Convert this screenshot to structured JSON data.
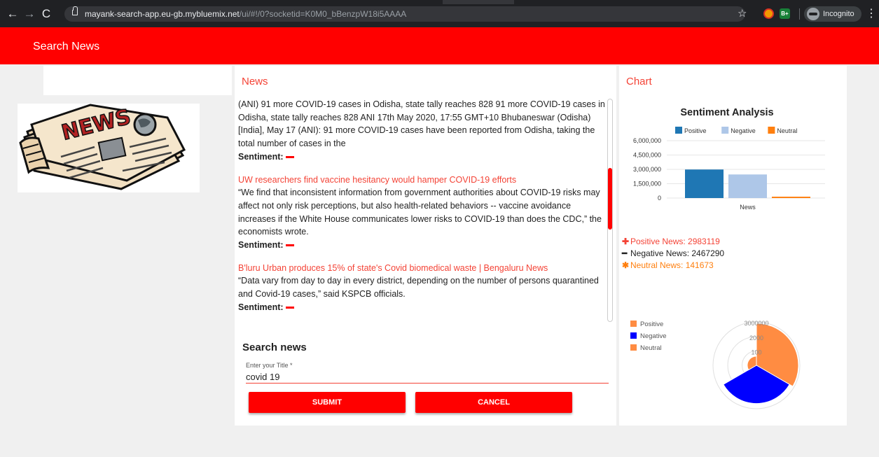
{
  "browser": {
    "url_host": "mayank-search-app.eu-gb.mybluemix.net",
    "url_path": "/ui/#!/0?socketid=K0M0_bBenzpW18i5AAAA",
    "incognito_label": "Incognito",
    "back_icon": "arrow-left-icon",
    "forward_icon": "arrow-right-icon",
    "reload_icon": "reload-icon",
    "bookmark_icon": "star-icon",
    "menu_icon": "kebab-icon"
  },
  "app": {
    "title": "Search News",
    "accent": "#ff0000"
  },
  "news": {
    "title": "News",
    "articles": [
      {
        "title": "",
        "body": "(ANI) 91 more COVID-19 cases in Odisha, state tally reaches 828 91 more COVID-19 cases in Odisha, state tally reaches 828 ANI 17th May 2020, 17:55 GMT+10 Bhubaneswar (Odisha) [India], May 17 (ANI): 91 more COVID-19 cases have been reported from Odisha, taking the total number of cases in the",
        "sentiment_label": "Sentiment:"
      },
      {
        "title": "UW researchers find vaccine hesitancy would hamper COVID-19 efforts",
        "body": "“We find that inconsistent information from government authorities about COVID-19 risks may affect not only risk perceptions, but also health-related behaviors -- vaccine avoidance increases if the White House communicates lower risks to COVID-19 than does the CDC,” the economists wrote.",
        "sentiment_label": "Sentiment:"
      },
      {
        "title": "B'luru Urban produces 15% of state's Covid biomedical waste | Bengaluru News",
        "body": "“Data vary from day to day in every district, depending on the number of persons quarantined and Covid-19 cases,” said KSPCB officials.",
        "sentiment_label": "Sentiment:"
      }
    ]
  },
  "search": {
    "title": "Search news",
    "field_label": "Enter your Title *",
    "value": "covid 19",
    "submit_label": "SUBMIT",
    "cancel_label": "CANCEL"
  },
  "chart_panel": {
    "title": "Chart"
  },
  "stats": {
    "positive_label": "Positive News: 2983119",
    "negative_label": "Negative News: 2467290",
    "neutral_label": "Neutral News: 141673"
  },
  "chart_data": [
    {
      "type": "bar",
      "title": "Sentiment Analysis",
      "categories": [
        "News"
      ],
      "series": [
        {
          "name": "Positive",
          "values": [
            2983119
          ],
          "color": "#1f77b4"
        },
        {
          "name": "Negative",
          "values": [
            2467290
          ],
          "color": "#aec7e8"
        },
        {
          "name": "Neutral",
          "values": [
            141673
          ],
          "color": "#ff7f0e"
        }
      ],
      "yticks": [
        "6,000,000",
        "4,500,000",
        "3,000,000",
        "1,500,000",
        "0"
      ],
      "ylim": [
        0,
        6000000
      ],
      "legend": "top"
    },
    {
      "type": "pie",
      "subtype": "polar-area",
      "labels": [
        "Positive",
        "Negative",
        "Neutral"
      ],
      "values": [
        2983119,
        2467290,
        141673
      ],
      "colors": [
        "#ff8c42",
        "#0000ff",
        "#ff8c42"
      ],
      "rticks": [
        "3000000",
        "2000",
        "100"
      ],
      "legend": "left"
    }
  ]
}
